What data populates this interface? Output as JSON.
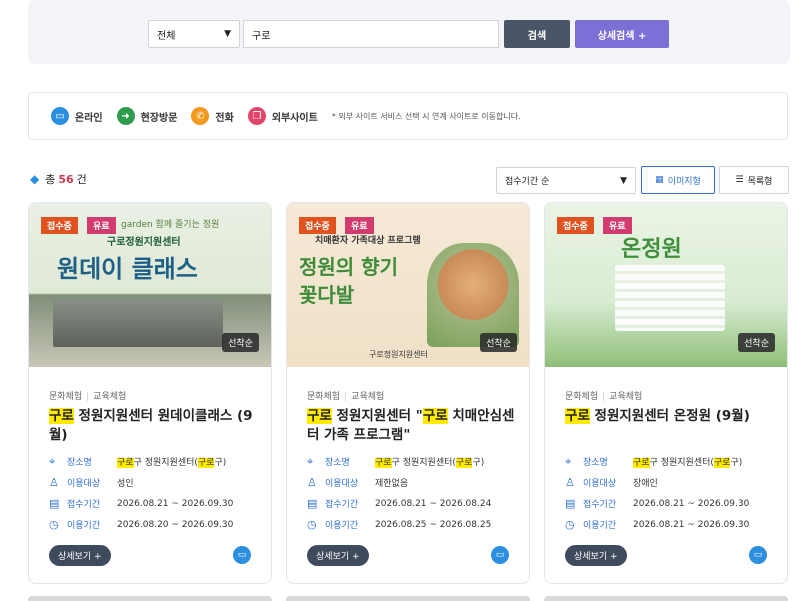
{
  "search": {
    "category_value": "전체",
    "keyword": "구로",
    "search_label": "검색",
    "advanced_label": "상세검색 +"
  },
  "filters": {
    "online": "온라인",
    "visit": "현장방문",
    "phone": "전화",
    "external": "외부사이트",
    "note": "* 외부 사이트 서비스 선택 시 연계 사이트로 이동합니다."
  },
  "results": {
    "prefix": "총",
    "count": "56",
    "suffix": "건",
    "sort_value": "접수기간 순",
    "view_image": "이미지형",
    "view_list": "목록형"
  },
  "labels": {
    "place": "장소명",
    "target": "이용대상",
    "reg_period": "접수기간",
    "use_period": "이용기간",
    "detail": "상세보기 +",
    "status_open": "접수중",
    "status_paid": "유료",
    "first_come": "선착순"
  },
  "cards": [
    {
      "cat1": "문화체험",
      "cat2": "교육체험",
      "title_hl": "구로",
      "title_rest": " 정원지원센터 원데이클래스 (9월)",
      "thumb_line1": "garden 함께 즐기는 정원",
      "thumb_line2": "구로정원지원센터",
      "thumb_title": "원데이 클래스",
      "place_hl1": "구로",
      "place_mid": "구 정원지원센터(",
      "place_hl2": "구로",
      "place_end": "구)",
      "target": "성인",
      "reg": "2026.08.21 ~ 2026.09.30",
      "use": "2026.08.20 ~ 2026.09.30"
    },
    {
      "cat1": "문화체험",
      "cat2": "교육체험",
      "title_hl": "구로",
      "title_rest": " 정원지원센터 \"",
      "title_hl2": "구로",
      "title_rest2": " 치매안심센터 가족 프로그램\"",
      "thumb_line1": "치매환자 가족대상 프로그램",
      "thumb_title": "정원의 향기 꽃다발",
      "thumb_foot": "구로정원지원센터",
      "place_hl1": "구로",
      "place_mid": "구 정원지원센터(",
      "place_hl2": "구로",
      "place_end": "구)",
      "target": "제한없음",
      "reg": "2026.08.21 ~ 2026.08.24",
      "use": "2026.08.25 ~ 2026.08.25"
    },
    {
      "cat1": "문화체험",
      "cat2": "교육체험",
      "title_hl": "구로",
      "title_rest": " 정원지원센터 온정원 (9월)",
      "thumb_title": "온정원",
      "place_hl1": "구로",
      "place_mid": "구 정원지원센터(",
      "place_hl2": "구로",
      "place_end": "구)",
      "target": "장애인",
      "reg": "2026.08.21 ~ 2026.09.30",
      "use": "2026.08.21 ~ 2026.09.30"
    }
  ]
}
